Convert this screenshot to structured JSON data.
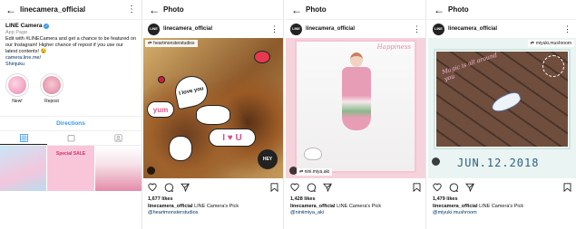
{
  "profile": {
    "header_username": "linecamera_official",
    "name": "LINE Camera",
    "category": "App Page",
    "bio": "Edit with #LINECamera and get a chance to be featured on our Instagram! Higher chance of repost if you use our latest contents! 😉",
    "website": "camera.line.me/",
    "location": "Shinjuku",
    "highlights": [
      {
        "label": "New!"
      },
      {
        "label": "Repost"
      }
    ],
    "directions_label": "Directions",
    "grid_labels": [
      "Special SALE"
    ]
  },
  "posts": [
    {
      "header_title": "Photo",
      "username": "linecamera_official",
      "avatar_text": "LINE",
      "repost_user": "heartmonsterstudios",
      "likes": "1,677 likes",
      "caption_prefix": "linecamera_official",
      "caption": "LINE Camera's Pick",
      "credit": "@heartmonsterstudios",
      "sticker_texts": [
        "I love you",
        "I ♥ U",
        "yum",
        "HEY"
      ]
    },
    {
      "header_title": "Photo",
      "username": "linecamera_official",
      "avatar_text": "LINE",
      "repost_user": "nini.miya.aki",
      "likes": "1,428 likes",
      "caption_prefix": "linecamera_official",
      "caption": "LINE Camera's Pick",
      "credit": "@niniimiya_aki",
      "overlay_text": "Happiness"
    },
    {
      "header_title": "Photo",
      "username": "linecamera_official",
      "avatar_text": "LINE",
      "repost_user": "miyuki.mushroom",
      "likes": "1,479 likes",
      "caption_prefix": "linecamera_official",
      "caption": "LINE Camera's Pick",
      "credit": "@miyuki.mushroom",
      "date_stamp": "JUN.12.2018",
      "overlay_text": "Magic is all around you"
    }
  ]
}
